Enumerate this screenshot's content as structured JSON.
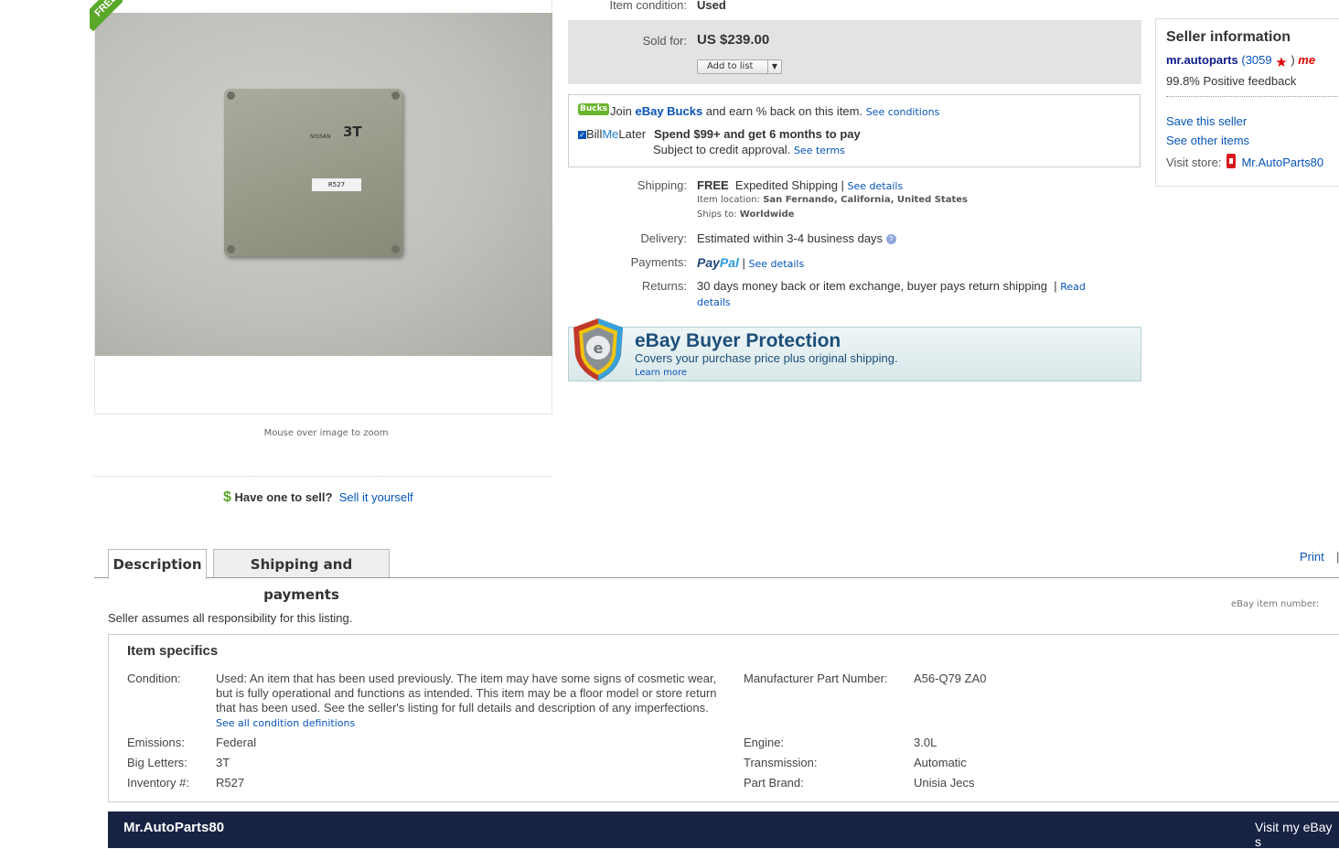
{
  "image": {
    "ribbon": "FREE",
    "label_text": "R527",
    "stamp_text": "3T",
    "brand_text": "NISSAN",
    "zoom_hint": "Mouse over image to zoom"
  },
  "sell": {
    "prompt": "Have one to sell?",
    "link": "Sell it yourself"
  },
  "listing": {
    "condition_label": "Item condition:",
    "condition_value": "Used",
    "sold_label": "Sold for:",
    "price": "US $239.00",
    "add_to_list": "Add to list"
  },
  "promo": {
    "bucks_logo": "Bucks",
    "bucks_prefix": "Join ",
    "bucks_brand": "eBay Bucks",
    "bucks_suffix": " and earn % back on this item.",
    "bucks_link": "See conditions",
    "bml_logo_a": "Bill",
    "bml_logo_b": "Me",
    "bml_logo_c": "Later",
    "bml_offer": "Spend $99+ and get 6 months to pay",
    "bml_sub": "Subject to credit approval.",
    "bml_link": "See terms"
  },
  "shipping": {
    "label": "Shipping:",
    "free": "FREE",
    "method": "Expedited Shipping",
    "details_link": "See details",
    "location_label": "Item location:",
    "location": "San Fernando, California, United States",
    "ships_to_label": "Ships to:",
    "ships_to": "Worldwide"
  },
  "delivery": {
    "label": "Delivery:",
    "value": "Estimated within 3-4 business days"
  },
  "payments": {
    "label": "Payments:",
    "paypal_a": "Pay",
    "paypal_b": "Pal",
    "details_link": "See details"
  },
  "returns": {
    "label": "Returns:",
    "value": "30 days money back or item exchange, buyer pays return shipping",
    "link": "Read details"
  },
  "buyer_protection": {
    "title": "eBay Buyer Protection",
    "subtitle": "Covers your purchase price plus original shipping.",
    "learn_more": "Learn more"
  },
  "seller": {
    "title": "Seller information",
    "name": "mr.autoparts",
    "feedback_count": "(3059",
    "close_paren": ")",
    "me_badge": "me",
    "positive": "99.8% Positive feedback",
    "save": "Save this seller",
    "other_items": "See other items",
    "visit_label": "Visit store:",
    "store_name": "Mr.AutoParts80"
  },
  "tabs": {
    "description": "Description",
    "shipping": "Shipping and payments",
    "print": "Print",
    "print_sep": "|"
  },
  "description": {
    "assumes": "Seller assumes all responsibility for this listing.",
    "item_number_label": "eBay item number:"
  },
  "specifics": {
    "title": "Item specifics",
    "condition_label": "Condition:",
    "condition_text": "Used: An item that has been used previously. The item may have some signs of cosmetic wear, but is fully operational and functions as intended. This item may be a floor model or store return that has been used. See the seller's listing for full details and description of any imperfections.",
    "condition_link": "See all condition definitions",
    "rows_left": [
      {
        "label": "Emissions:",
        "value": "Federal"
      },
      {
        "label": "Big Letters:",
        "value": "3T"
      },
      {
        "label": "Inventory #:",
        "value": "R527"
      }
    ],
    "rows_right": [
      {
        "label": "Manufacturer Part Number:",
        "value": "A56-Q79 ZA0"
      },
      {
        "label": "Engine:",
        "value": "3.0L"
      },
      {
        "label": "Transmission:",
        "value": "Automatic"
      },
      {
        "label": "Part Brand:",
        "value": "Unisia Jecs"
      }
    ]
  },
  "store_bar": {
    "name": "Mr.AutoParts80",
    "visit": "Visit my eBay s"
  },
  "colors": {
    "link": "#0654ba",
    "price_box": "#e3e3e3",
    "store_bar": "#182344",
    "bucks_green": "#6bb52d"
  }
}
